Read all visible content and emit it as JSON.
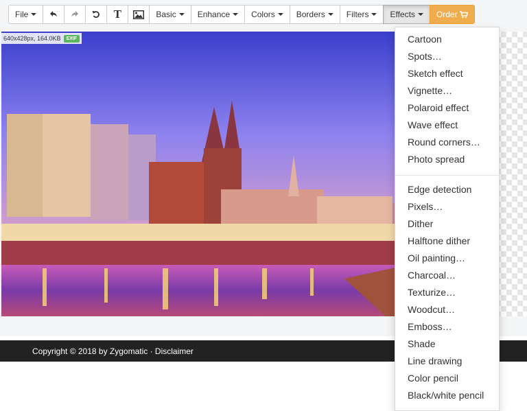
{
  "toolbar": {
    "file_label": "File",
    "undo_icon": "undo-arrow-icon",
    "redo_icon": "redo-arrow-icon",
    "rotate_icon": "rotate-icon",
    "text_glyph": "T",
    "image_icon": "image-icon",
    "basic_label": "Basic",
    "enhance_label": "Enhance",
    "colors_label": "Colors",
    "borders_label": "Borders",
    "filters_label": "Filters",
    "effects_label": "Effects",
    "order_label": "Order",
    "order_icon": "cart-icon",
    "accent_color": "#f0ad4e"
  },
  "image_info": {
    "text": "640x428px, 164.0KB",
    "badge": "EXIF",
    "badge_color": "#5cb85c"
  },
  "footer": {
    "copyright": "Copyright © 2018 by Zygomatic · Disclaimer"
  },
  "effects_menu": {
    "group1": [
      "Cartoon",
      "Spots…",
      "Sketch effect",
      "Vignette…",
      "Polaroid effect",
      "Wave effect",
      "Round corners…",
      "Photo spread"
    ],
    "group2": [
      "Edge detection",
      "Pixels…",
      "Dither",
      "Halftone dither",
      "Oil painting…",
      "Charcoal…",
      "Texturize…",
      "Woodcut…",
      "Emboss…",
      "Shade",
      "Line drawing",
      "Color pencil",
      "Black/white pencil"
    ]
  }
}
